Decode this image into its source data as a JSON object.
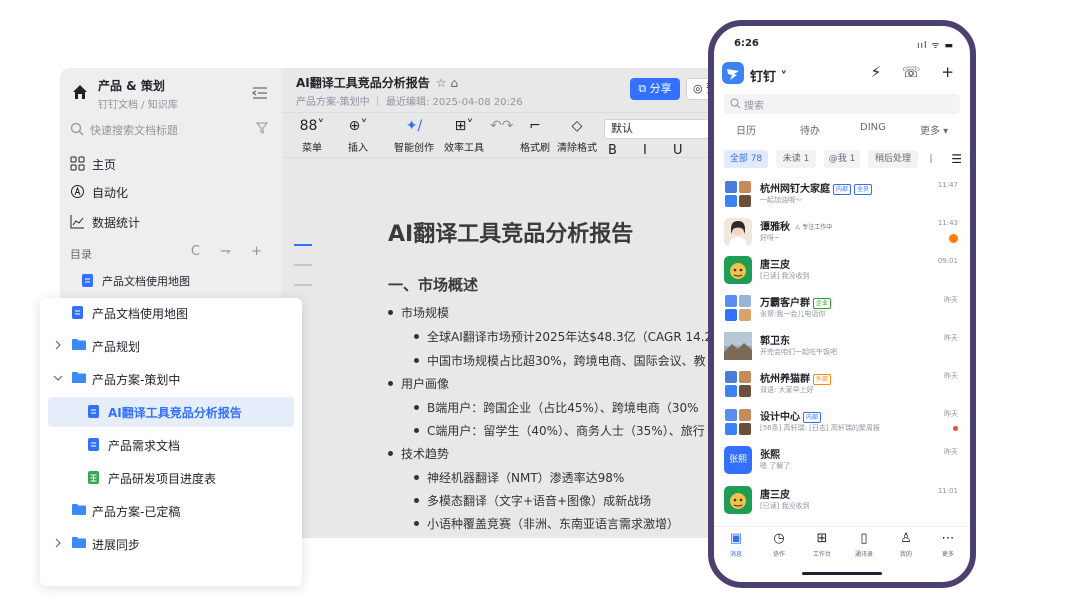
{
  "desktop": {
    "sidebar": {
      "space_title": "产品 & 策划",
      "space_sub": "钉钉文档 / 知识库",
      "search_placeholder": "快速搜索文档标题",
      "nav": [
        "主页",
        "自动化",
        "数据统计"
      ],
      "toc_label": "目录",
      "toc_tools": "C ⇁ +",
      "toc_first": "产品文档使用地图"
    },
    "doc": {
      "title": "AI翻译工具竞品分析报告",
      "title_icons": "☆ ⌂",
      "meta": "产品方案-策划中 ｜ 最近编辑: 2025-04-08 20:26",
      "share_label": "⧉ 分享",
      "eye_label": "◎ 预",
      "toolbar": [
        {
          "glyph": "88˅",
          "label": "菜单"
        },
        {
          "glyph": "⊕˅",
          "label": "插入"
        },
        {
          "glyph": "✦/",
          "label": "智能创作"
        },
        {
          "glyph": "⊞˅",
          "label": "效率工具"
        },
        {
          "glyph": "↶↷",
          "label": ""
        },
        {
          "glyph": "⌐",
          "label": "格式刷"
        },
        {
          "glyph": "◇",
          "label": "清除格式"
        }
      ],
      "font_select": "默认",
      "format_row": "B I U S X",
      "heading": "AI翻译工具竞品分析报告",
      "section_title": "一、市场概述",
      "bullets": [
        {
          "level": 1,
          "text": "市场规模"
        },
        {
          "level": 2,
          "text": "全球AI翻译市场预计2025年达$48.3亿（CAGR 14.2"
        },
        {
          "level": 2,
          "text": "中国市场规模占比超30%，跨境电商、国际会议、教"
        },
        {
          "level": 1,
          "text": "用户画像"
        },
        {
          "level": 2,
          "text": "B端用户：跨国企业（占比45%）、跨境电商（30%"
        },
        {
          "level": 2,
          "text": "C端用户：留学生（40%）、商务人士（35%）、旅行"
        },
        {
          "level": 1,
          "text": "技术趋势"
        },
        {
          "level": 2,
          "text": "神经机器翻译（NMT）渗透率达98%"
        },
        {
          "level": 2,
          "text": "多模态翻译（文字+语音+图像）成新战场"
        },
        {
          "level": 2,
          "text": "小语种覆盖竞赛（非洲、东南亚语言需求激增）"
        }
      ]
    }
  },
  "tree": [
    {
      "label": "产品文档使用地图",
      "type": "doc",
      "depth": 0,
      "chevron": "none",
      "active": false
    },
    {
      "label": "产品规划",
      "type": "folder",
      "depth": 0,
      "chevron": "right",
      "active": false
    },
    {
      "label": "产品方案-策划中",
      "type": "folder",
      "depth": 0,
      "chevron": "down",
      "active": false
    },
    {
      "label": "AI翻译工具竞品分析报告",
      "type": "doc",
      "depth": 1,
      "chevron": "none",
      "active": true
    },
    {
      "label": "产品需求文档",
      "type": "doc",
      "depth": 1,
      "chevron": "none",
      "active": false
    },
    {
      "label": "产品研发项目进度表",
      "type": "sheet",
      "depth": 1,
      "chevron": "none",
      "active": false
    },
    {
      "label": "产品方案-已定稿",
      "type": "folder",
      "depth": 0,
      "chevron": "none",
      "active": false
    },
    {
      "label": "进展同步",
      "type": "folder",
      "depth": 0,
      "chevron": "right",
      "active": false
    }
  ],
  "phone": {
    "time": "6:26",
    "status_icons": "ııl ᯤ ▬",
    "app_name": "钉钉 ˅",
    "app_actions": "⚡ ☏ +",
    "search_placeholder": "搜索",
    "quick": [
      "日历",
      "待办",
      "DING",
      "更多 ▾"
    ],
    "filters": [
      "全部 78",
      "未读 1",
      "@我 1",
      "稍后处理",
      "|"
    ],
    "menu_icon": "☰",
    "chats": [
      {
        "name": "杭州网钉大家庭",
        "tags": [
          "内部",
          "全员"
        ],
        "preview": "一起加油哦～",
        "time": "11:47",
        "mark": ""
      },
      {
        "name": "谭雅秋",
        "tags": [
          "⚠ 专注工作中"
        ],
        "preview": "好呀~",
        "time": "11:43",
        "mark": "badge"
      },
      {
        "name": "唐三皮",
        "tags": [],
        "preview": "[已读] 我没收到",
        "time": "09:01",
        "mark": ""
      },
      {
        "name": "万霸客户群",
        "tags": [
          "企业"
        ],
        "preview": "张帮:我一会儿电话你",
        "time": "昨天",
        "mark": ""
      },
      {
        "name": "郭卫东",
        "tags": [],
        "preview": "开完会咱们一起吃午饭吧",
        "time": "昨天",
        "mark": ""
      },
      {
        "name": "杭州养猫群",
        "tags": [
          "外部"
        ],
        "preview": "双语: 大家早上好",
        "time": "昨天",
        "mark": ""
      },
      {
        "name": "设计中心",
        "tags": [
          "内部"
        ],
        "preview": "[56条] 高轩瑞: [日志] 高轩瑞的聚周报",
        "time": "昨天",
        "mark": "dot"
      },
      {
        "name": "张熙",
        "tags": [],
        "preview": "嗯 了解了",
        "time": "昨天",
        "mark": ""
      },
      {
        "name": "唐三皮",
        "tags": [],
        "preview": "[已读] 我没收到",
        "time": "11:01",
        "mark": ""
      }
    ],
    "avatar_text_zhangxi": "张熙",
    "bottom_nav": [
      {
        "glyph": "▣",
        "label": "消息"
      },
      {
        "glyph": "◷",
        "label": "协作"
      },
      {
        "glyph": "⊞",
        "label": "工作台"
      },
      {
        "glyph": "▯",
        "label": "通讯录"
      },
      {
        "glyph": "♙",
        "label": "我的"
      },
      {
        "glyph": "⋯",
        "label": "更多"
      }
    ]
  }
}
